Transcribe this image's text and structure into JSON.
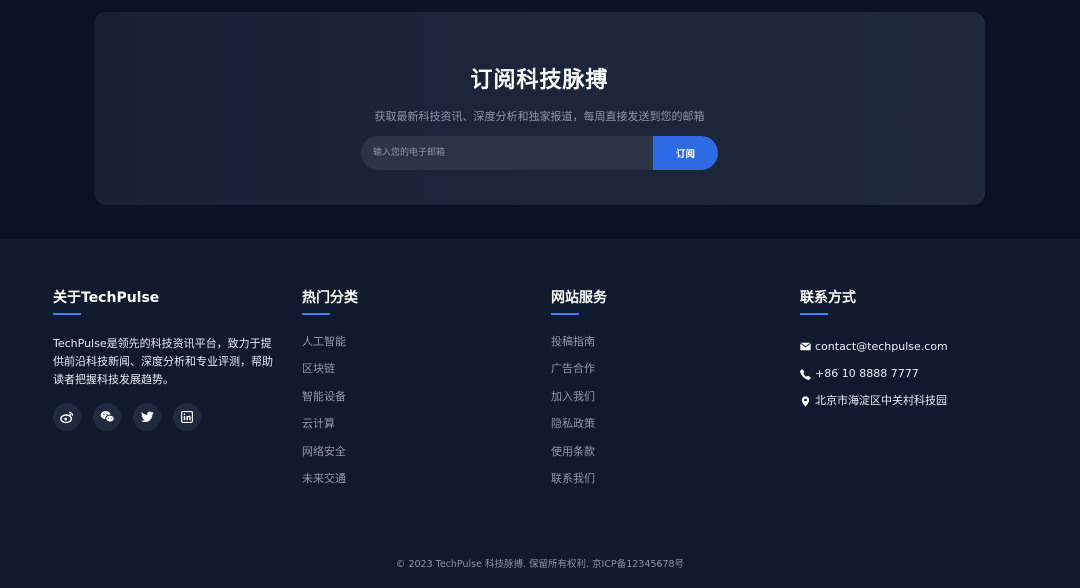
{
  "subscribe": {
    "title": "订阅科技脉搏",
    "description": "获取最新科技资讯、深度分析和独家报道，每周直接发送到您的邮箱",
    "email_placeholder": "输入您的电子邮箱",
    "button_label": "订阅"
  },
  "footer": {
    "about": {
      "title": "关于TechPulse",
      "text": "TechPulse是领先的科技资讯平台，致力于提供前沿科技新闻、深度分析和专业评测，帮助读者把握科技发展趋势。",
      "socials": [
        "weibo-icon",
        "wechat-icon",
        "twitter-icon",
        "linkedin-icon"
      ]
    },
    "categories": {
      "title": "热门分类",
      "items": [
        "人工智能",
        "区块链",
        "智能设备",
        "云计算",
        "网络安全",
        "未来交通"
      ]
    },
    "services": {
      "title": "网站服务",
      "items": [
        "投稿指南",
        "广告合作",
        "加入我们",
        "隐私政策",
        "使用条款",
        "联系我们"
      ]
    },
    "contact": {
      "title": "联系方式",
      "email": "contact@techpulse.com",
      "phone": "+86 10 8888 7777",
      "address": "北京市海淀区中关村科技园"
    },
    "copyright": "© 2023 TechPulse 科技脉搏. 保留所有权利. 京ICP备12345678号"
  },
  "colors": {
    "accent": "#2d6ae3",
    "underline": "#3b82f6",
    "background": "#0f1a2e"
  }
}
